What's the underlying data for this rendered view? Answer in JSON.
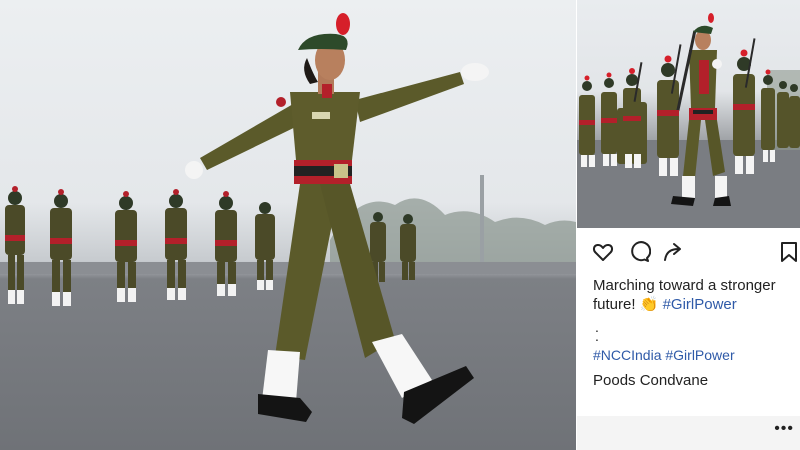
{
  "post": {
    "caption_text": "Marching toward a stronger future!",
    "caption_emoji": "👏",
    "caption_hashtag": "#GirlPower",
    "dot1": ".",
    "dot2": ".",
    "hashtag1": "#NCCIndia",
    "hashtag2": "#GirlPower",
    "account_name": "Poods Condvane",
    "more_label": "•••"
  },
  "icons": {
    "like": "heart-icon",
    "comment": "comment-icon",
    "share": "share-arrow-icon",
    "save": "bookmark-icon",
    "more": "more-dots-icon"
  },
  "colors": {
    "uniform": "#5b5a2a",
    "beret": "#2d4a2a",
    "plume": "#d61f2a",
    "sash": "#b3202a",
    "hashtag": "#2f5aa8"
  }
}
